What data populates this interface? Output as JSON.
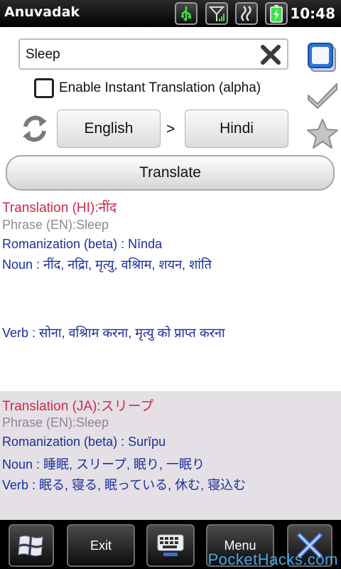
{
  "statusbar": {
    "title": "Anuvadak",
    "clock": "10:48",
    "icons": [
      "usb-icon",
      "signal-icon",
      "data-icon",
      "battery-charging-icon"
    ]
  },
  "search": {
    "value": "Sleep",
    "clear_icon": "close-icon"
  },
  "side_icons": [
    "copy-icon",
    "checkmark-icon",
    "favorite-star-icon"
  ],
  "instant": {
    "label": "Enable Instant Translation (alpha)",
    "checked": false
  },
  "languages": {
    "from": "English",
    "separator": ">",
    "to": "Hindi",
    "swap_icon": "swap-icon"
  },
  "translate_label": "Translate",
  "results": {
    "hi": {
      "translation": "Translation (HI):नींद",
      "phrase": "Phrase (EN):Sleep",
      "romanization": "Romanization (beta) : Nīnda",
      "noun": "Noun : नींद, नद्रिा, मृत्यु, वश्रिाम, शयन, शांति",
      "verb": "Verb : सोना, वश्रिाम करना, मृत्यु को प्राप्त करना"
    },
    "ja": {
      "translation": "Translation (JA):スリープ",
      "phrase": "Phrase (EN):Sleep",
      "romanization": "Romanization (beta) : Surīpu",
      "noun": "Noun : 睡眠, スリープ, 眠り, 一眠り",
      "verb": "Verb : 眠る, 寝る, 眠っている, 休む, 寝込む"
    }
  },
  "bottombar": {
    "start_icon": "windows-start-icon",
    "exit_label": "Exit",
    "keyboard_icon": "keyboard-icon",
    "menu_label": "Menu",
    "close_icon": "close-icon"
  },
  "watermark": "PocketHacks.com",
  "colors": {
    "translation": "#cc2b4a",
    "phrase": "#8a8a8a",
    "info": "#1a2fa0",
    "ja_background": "#e4e0e6",
    "close": "#3b6fd8"
  }
}
